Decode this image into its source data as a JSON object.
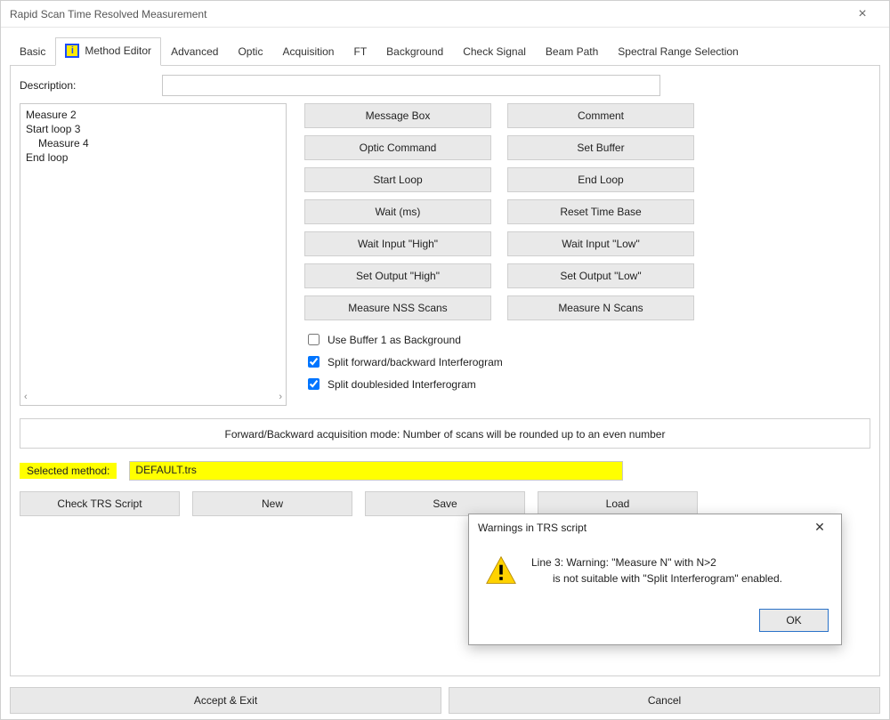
{
  "window": {
    "title": "Rapid Scan Time Resolved Measurement"
  },
  "tabs": {
    "basic": "Basic",
    "method_editor": "Method Editor",
    "advanced": "Advanced",
    "optic": "Optic",
    "acquisition": "Acquisition",
    "ft": "FT",
    "background": "Background",
    "check_signal": "Check Signal",
    "beam_path": "Beam Path",
    "spectral_range": "Spectral Range Selection",
    "active": "method_editor"
  },
  "description": {
    "label": "Description:",
    "value": ""
  },
  "script": {
    "lines": [
      "Measure 2",
      "Start loop 3",
      "Measure 4",
      "End loop"
    ],
    "indented_indices": [
      2
    ]
  },
  "commands": {
    "left": [
      "Message Box",
      "Optic Command",
      "Start Loop",
      "Wait (ms)",
      "Wait Input \"High\"",
      "Set Output \"High\"",
      "Measure NSS Scans"
    ],
    "right": [
      "Comment",
      "Set Buffer",
      "End Loop",
      "Reset Time Base",
      "Wait Input \"Low\"",
      "Set Output \"Low\"",
      "Measure N Scans"
    ]
  },
  "checks": {
    "use_buffer1_bg": {
      "label": "Use Buffer 1 as Background",
      "checked": false
    },
    "split_fwd_bwd": {
      "label": "Split forward/backward Interferogram",
      "checked": true
    },
    "split_double": {
      "label": "Split doublesided Interferogram",
      "checked": true
    }
  },
  "rule_note": "Forward/Backward acquisition mode: Number of scans will be rounded up to an even number",
  "selected_method": {
    "label": "Selected method:",
    "value": "DEFAULT.trs"
  },
  "action_buttons": {
    "check": "Check TRS Script",
    "new": "New",
    "save": "Save",
    "load": "Load"
  },
  "bottom": {
    "accept": "Accept & Exit",
    "cancel": "Cancel"
  },
  "modal": {
    "title": "Warnings in TRS script",
    "line1": "Line   3: Warning: \"Measure N\" with N>2",
    "line2": "is not suitable with \"Split Interferogram\" enabled.",
    "ok": "OK"
  }
}
